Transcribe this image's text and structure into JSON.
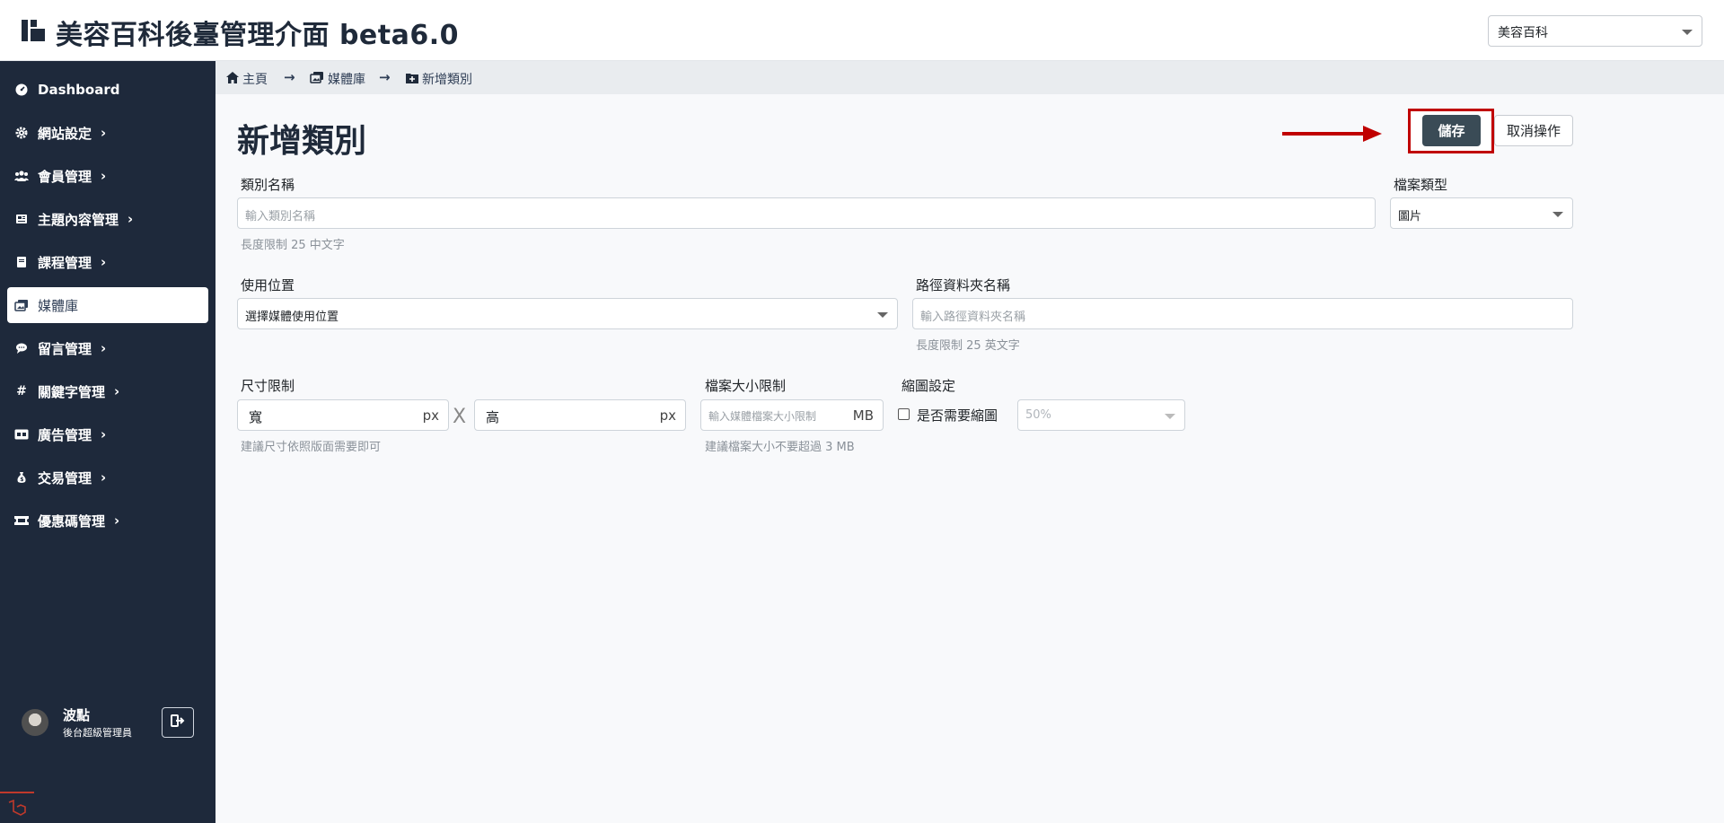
{
  "header": {
    "title": "美容百科後臺管理介面 beta6.0",
    "site_select": "美容百科"
  },
  "sidebar": {
    "items": [
      {
        "label": "Dashboard",
        "icon": "gauge-icon"
      },
      {
        "label": "網站設定",
        "icon": "gear-icon"
      },
      {
        "label": "會員管理",
        "icon": "users-icon"
      },
      {
        "label": "主題內容管理",
        "icon": "newspaper-icon"
      },
      {
        "label": "課程管理",
        "icon": "book-icon"
      },
      {
        "label": "媒體庫",
        "icon": "images-icon"
      },
      {
        "label": "留言管理",
        "icon": "comment-icon"
      },
      {
        "label": "關鍵字管理",
        "icon": "hashtag-icon"
      },
      {
        "label": "廣告管理",
        "icon": "ad-icon"
      },
      {
        "label": "交易管理",
        "icon": "money-bag-icon"
      },
      {
        "label": "優惠碼管理",
        "icon": "ticket-icon"
      }
    ],
    "user": {
      "name": "波點",
      "role": "後台超級管理員"
    }
  },
  "breadcrumb": {
    "home": "主頁",
    "media": "媒體庫",
    "current": "新增類別"
  },
  "page": {
    "title": "新增類別",
    "save_label": "儲存",
    "cancel_label": "取消操作"
  },
  "form": {
    "category_name": {
      "label": "類別名稱",
      "placeholder": "輸入類別名稱",
      "help": "長度限制 25 中文字"
    },
    "file_type": {
      "label": "檔案類型",
      "value": "圖片"
    },
    "usage": {
      "label": "使用位置",
      "value": "選擇媒體使用位置"
    },
    "folder": {
      "label": "路徑資料夾名稱",
      "placeholder": "輸入路徑資料夾名稱",
      "help": "長度限制 25 英文字"
    },
    "size": {
      "label": "尺寸限制",
      "width_placeholder": "寬",
      "height_placeholder": "高",
      "unit": "px",
      "times": "X",
      "help": "建議尺寸依照版面需要即可"
    },
    "filesize": {
      "label": "檔案大小限制",
      "placeholder": "輸入媒體檔案大小限制",
      "unit": "MB",
      "help": "建議檔案大小不要超過 3 MB"
    },
    "thumb": {
      "label": "縮圖設定",
      "checkbox_label": "是否需要縮圖",
      "value": "50%"
    }
  }
}
